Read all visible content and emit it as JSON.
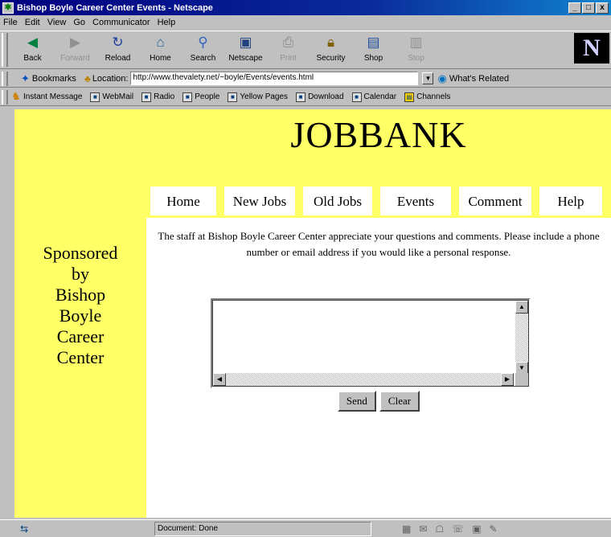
{
  "window": {
    "title": "Bishop Boyle Career Center Events - Netscape",
    "controls": [
      "_",
      "□",
      "x"
    ]
  },
  "menu": [
    "File",
    "Edit",
    "View",
    "Go",
    "Communicator",
    "Help"
  ],
  "toolbar": {
    "buttons": [
      {
        "label": "Back",
        "icon": "back-arrow-icon",
        "enabled": true
      },
      {
        "label": "Forward",
        "icon": "forward-arrow-icon",
        "enabled": false
      },
      {
        "label": "Reload",
        "icon": "reload-icon",
        "enabled": true
      },
      {
        "label": "Home",
        "icon": "home-icon",
        "enabled": true
      },
      {
        "label": "Search",
        "icon": "search-icon",
        "enabled": true
      },
      {
        "label": "Netscape",
        "icon": "netscape-icon",
        "enabled": true
      },
      {
        "label": "Print",
        "icon": "print-icon",
        "enabled": false
      },
      {
        "label": "Security",
        "icon": "lock-icon",
        "enabled": true
      },
      {
        "label": "Shop",
        "icon": "shop-icon",
        "enabled": true
      },
      {
        "label": "Stop",
        "icon": "stop-icon",
        "enabled": false
      }
    ],
    "logo": "N"
  },
  "location": {
    "bookmarks_label": "Bookmarks",
    "location_label": "Location:",
    "url": "http://www.thevalety.net/~boyle/Events/events.html",
    "related_label": "What's Related"
  },
  "personal_toolbar": [
    "Instant Message",
    "WebMail",
    "Radio",
    "People",
    "Yellow Pages",
    "Download",
    "Calendar",
    "Channels"
  ],
  "page": {
    "title": "JOBBANK",
    "nav": [
      "Home",
      "New Jobs",
      "Old Jobs",
      "Events",
      "Comment",
      "Help"
    ],
    "sponsor_lines": [
      "Sponsored",
      "by",
      "Bishop",
      "Boyle",
      "Career",
      "Center"
    ],
    "intro": "The staff at Bishop Boyle Career Center appreciate your questions and comments. Please include a phone number or email address if you would like a personal response.",
    "comment_value": "",
    "send_label": "Send",
    "clear_label": "Clear",
    "colors": {
      "background": "#ffff66",
      "content": "#ffffff"
    }
  },
  "status": {
    "text": "Document: Done"
  }
}
